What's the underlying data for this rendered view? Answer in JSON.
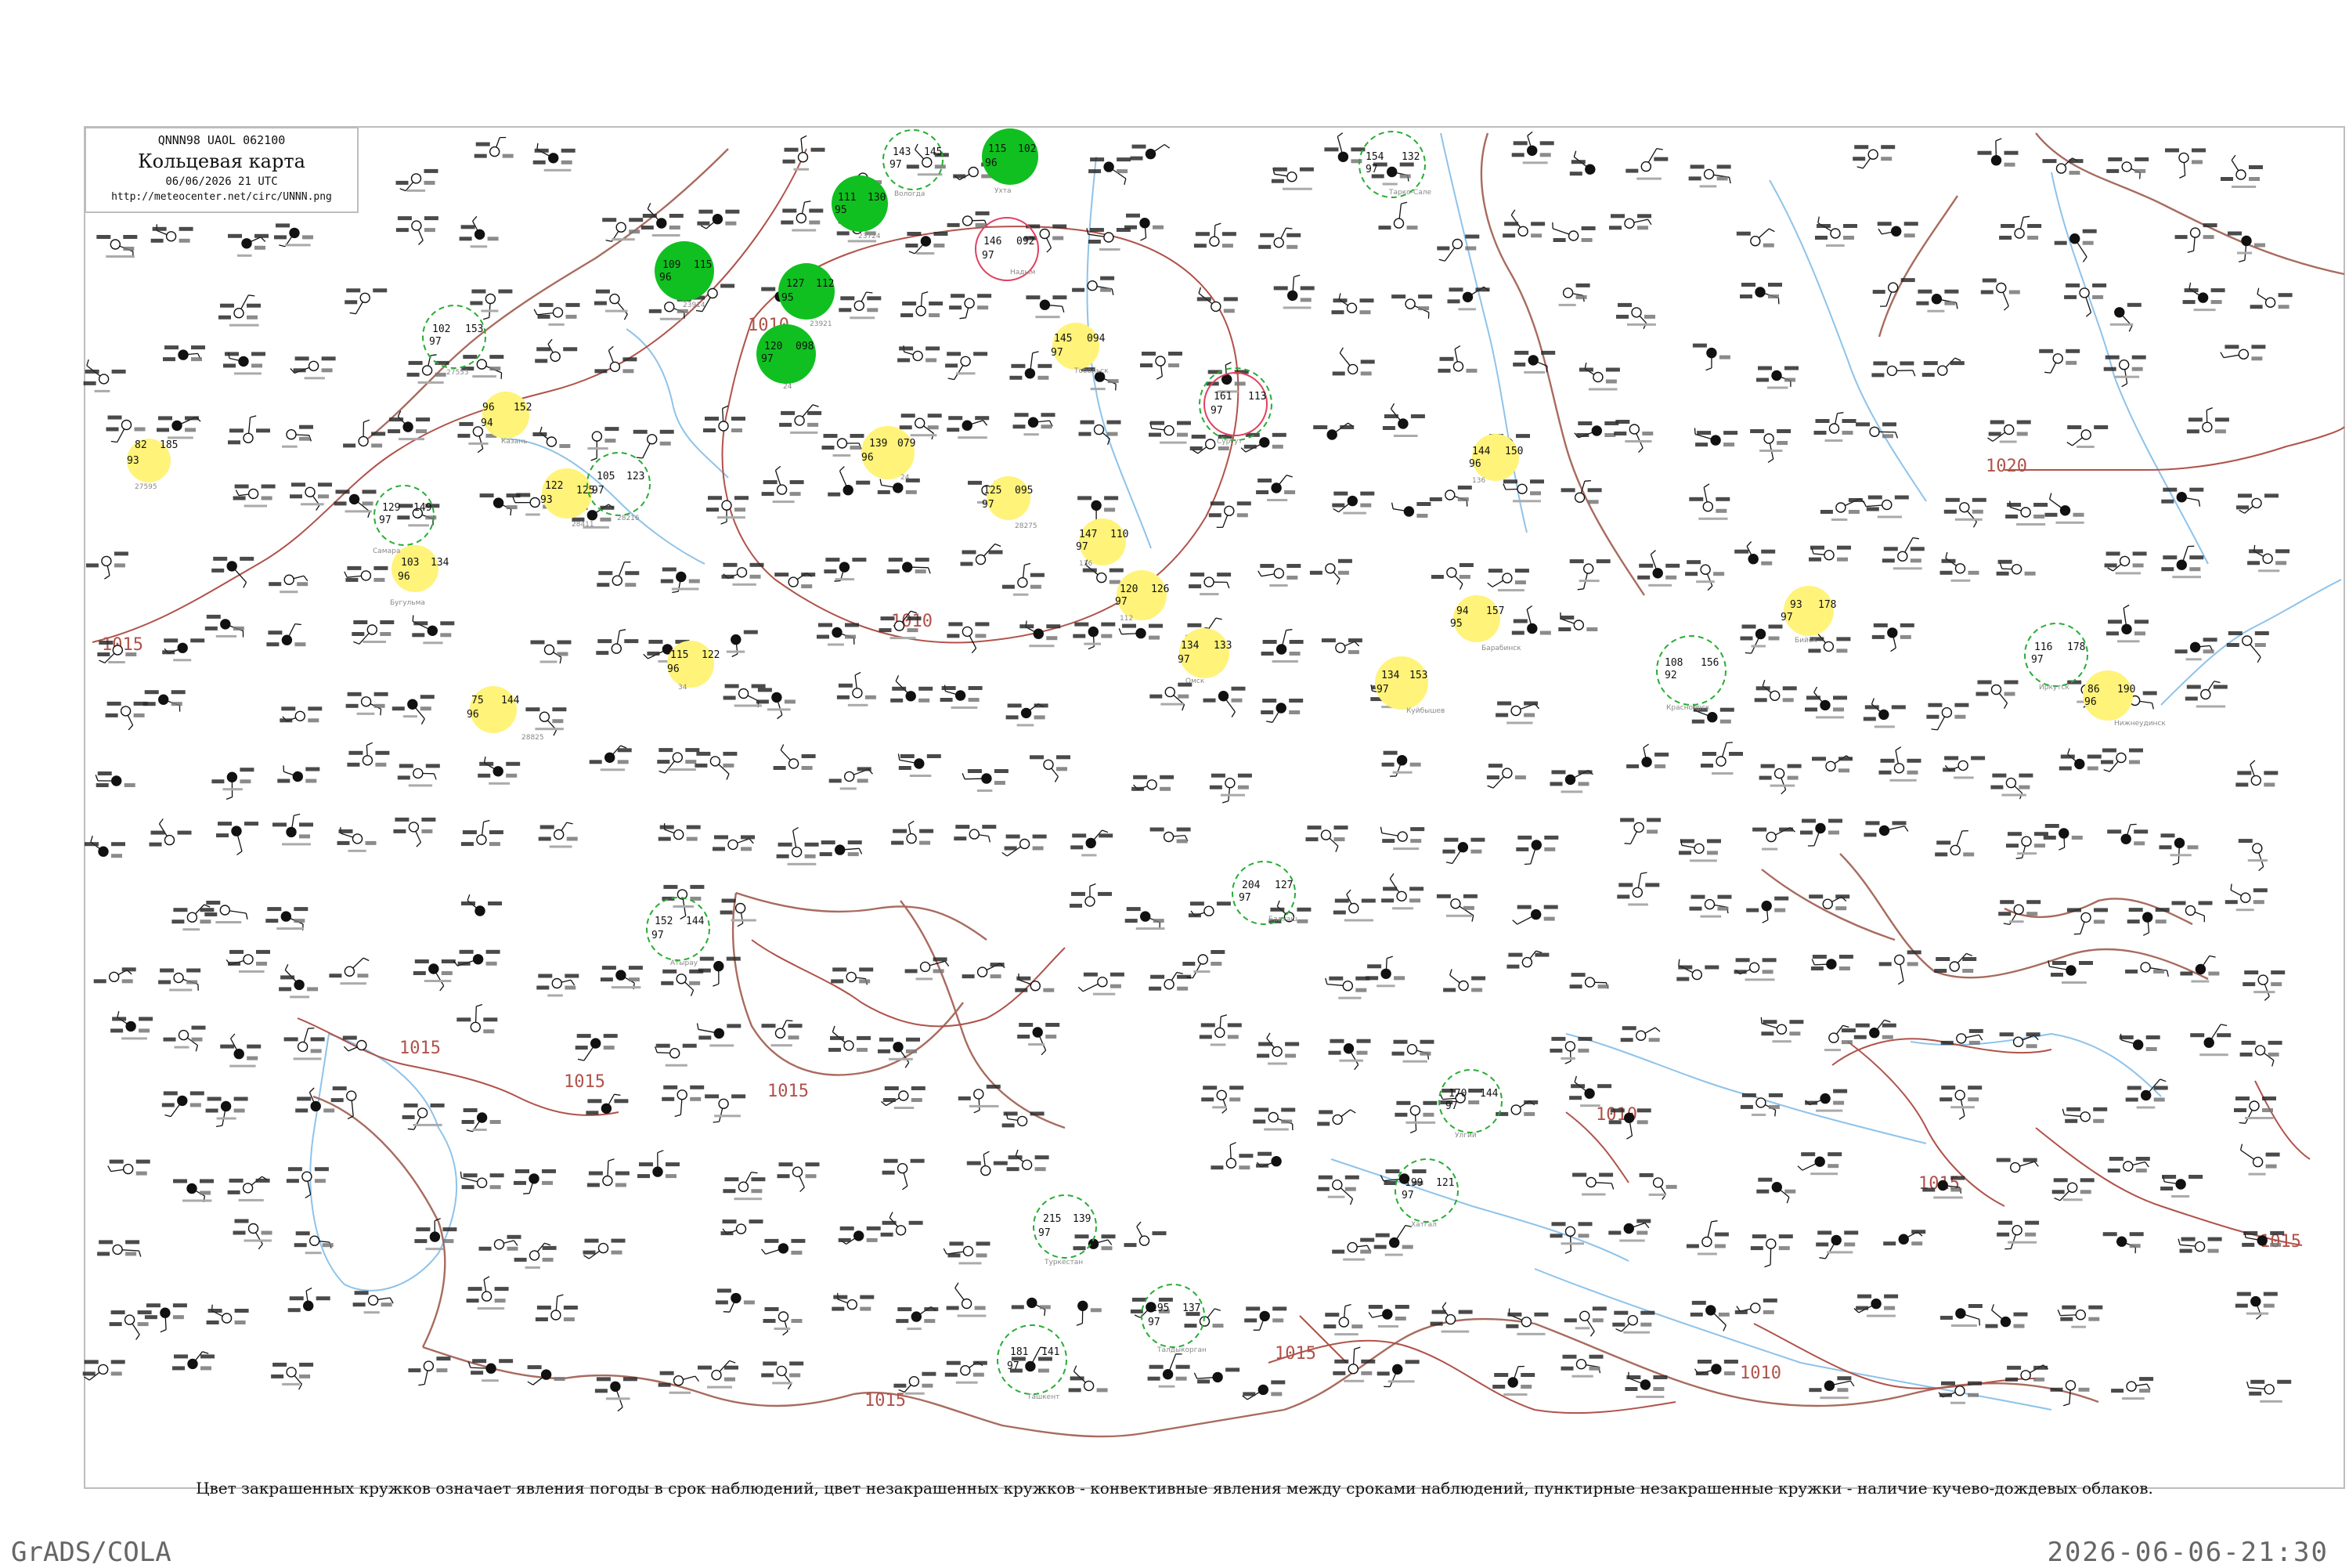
{
  "header": {
    "code": "QNNN98  UAOL  062100",
    "title": "Кольцевая карта",
    "datetime": "06/06/2026 21 UTC",
    "url": "http://meteocenter.net/circ/UNNN.png"
  },
  "caption": "Цвет закрашенных кружков означает явления погоды в срок наблюдений, цвет незакрашенных кружков - конвективные явления между сроками наблюдений, пунктирные незакрашенные кружки - наличие кучево-дождевых облаков.",
  "footer": {
    "left": "GrADS/COLA",
    "right": "2026-06-06-21:30"
  },
  "colors": {
    "isobar": "#b0524a",
    "water": "#8ec3ea",
    "frame": "#bdbdbd",
    "rain_fill": "#10c020",
    "shower_fill": "#fff37a",
    "cb_ring": "#27ad34",
    "thunder_ring": "#e04060"
  },
  "isobars": [
    {
      "label": "1010"
    },
    {
      "label": "1010"
    },
    {
      "label": "1015"
    },
    {
      "label": "1015"
    },
    {
      "label": "1015"
    },
    {
      "label": "1015"
    },
    {
      "label": "1015"
    },
    {
      "label": "1015"
    },
    {
      "label": "1020"
    },
    {
      "label": "1010"
    },
    {
      "label": "1010"
    },
    {
      "label": "1015"
    },
    {
      "label": "1015"
    }
  ],
  "stations": [
    {
      "temp": "82",
      "dew": "93",
      "press": "185",
      "name": "27595",
      "kind": "yellow"
    },
    {
      "temp": "96",
      "dew": "94",
      "press": "152",
      "name": "Казань",
      "kind": "yellow"
    },
    {
      "temp": "122",
      "dew": "93",
      "press": "125",
      "name": "28411",
      "kind": "yellow"
    },
    {
      "temp": "103",
      "dew": "96",
      "press": "134",
      "name": "Бугульма",
      "kind": "yellow"
    },
    {
      "temp": "75",
      "dew": "96",
      "press": "144",
      "name": "28825",
      "kind": "yellow"
    },
    {
      "temp": "115",
      "dew": "96",
      "press": "122",
      "name": "34",
      "kind": "yellow"
    },
    {
      "temp": "139",
      "dew": "96",
      "press": "079",
      "name": "24",
      "kind": "yellow"
    },
    {
      "temp": "125",
      "dew": "97",
      "press": "095",
      "name": "28275",
      "kind": "yellow"
    },
    {
      "temp": "145",
      "dew": "97",
      "press": "094",
      "name": "Тобольск",
      "kind": "yellow"
    },
    {
      "temp": "147",
      "dew": "97",
      "press": "110",
      "name": "136",
      "kind": "yellow"
    },
    {
      "temp": "120",
      "dew": "97",
      "press": "126",
      "name": "112",
      "kind": "yellow"
    },
    {
      "temp": "134",
      "dew": "97",
      "press": "133",
      "name": "Омск",
      "kind": "yellow"
    },
    {
      "temp": "134",
      "dew": "97",
      "press": "153",
      "name": "Куйбышев",
      "kind": "yellow"
    },
    {
      "temp": "144",
      "dew": "96",
      "press": "150",
      "name": "136",
      "kind": "yellow"
    },
    {
      "temp": "94",
      "dew": "95",
      "press": "157",
      "name": "Барабинск",
      "kind": "yellow"
    },
    {
      "temp": "93",
      "dew": "97",
      "press": "178",
      "name": "Бийск",
      "kind": "yellow"
    },
    {
      "temp": "86",
      "dew": "96",
      "press": "190",
      "name": "Нижнеудинск",
      "kind": "yellow"
    },
    {
      "temp": "115",
      "dew": "96",
      "press": "102",
      "name": "Ухта",
      "kind": "green"
    },
    {
      "temp": "111",
      "dew": "95",
      "press": "130",
      "name": "23724",
      "kind": "green"
    },
    {
      "temp": "109",
      "dew": "96",
      "press": "115",
      "name": "23914",
      "kind": "green"
    },
    {
      "temp": "127",
      "dew": "95",
      "press": "112",
      "name": "23921",
      "kind": "green"
    },
    {
      "temp": "120",
      "dew": "97",
      "press": "098",
      "name": "24",
      "kind": "green"
    },
    {
      "temp": "143",
      "dew": "97",
      "press": "145",
      "name": "Вологда",
      "kind": "cb"
    },
    {
      "temp": "102",
      "dew": "97",
      "press": "153",
      "name": "27553",
      "kind": "cb"
    },
    {
      "temp": "105",
      "dew": "97",
      "press": "123",
      "name": "28216",
      "kind": "cb"
    },
    {
      "temp": "129",
      "dew": "97",
      "press": "149",
      "name": "Самара",
      "kind": "cb"
    },
    {
      "temp": "161",
      "dew": "97",
      "press": "113",
      "name": "Сургут",
      "kind": "thunder"
    },
    {
      "temp": "146",
      "dew": "97",
      "press": "092",
      "name": "Надым",
      "kind": "thunder"
    },
    {
      "temp": "154",
      "dew": "97",
      "press": "132",
      "name": "Тарко-Сале",
      "kind": "cb"
    },
    {
      "temp": "152",
      "dew": "97",
      "press": "144",
      "name": "Атырау",
      "kind": "cb"
    },
    {
      "temp": "204",
      "dew": "97",
      "press": "127",
      "name": "Балхаш",
      "kind": "cb"
    },
    {
      "temp": "215",
      "dew": "97",
      "press": "139",
      "name": "Туркестан",
      "kind": "cb"
    },
    {
      "temp": "181",
      "dew": "97",
      "press": "141",
      "name": "Ташкент",
      "kind": "cb"
    },
    {
      "temp": "195",
      "dew": "97",
      "press": "137",
      "name": "Талдыкорган",
      "kind": "cb"
    },
    {
      "temp": "170",
      "dew": "97",
      "press": "144",
      "name": "Улгий",
      "kind": "cb"
    },
    {
      "temp": "199",
      "dew": "97",
      "press": "121",
      "name": "Хатгал",
      "kind": "cb"
    },
    {
      "temp": "108",
      "dew": "92",
      "press": "156",
      "name": "Красноярск",
      "kind": "cb"
    },
    {
      "temp": "116",
      "dew": "97",
      "press": "178",
      "name": "Иркутск",
      "kind": "cb"
    }
  ]
}
